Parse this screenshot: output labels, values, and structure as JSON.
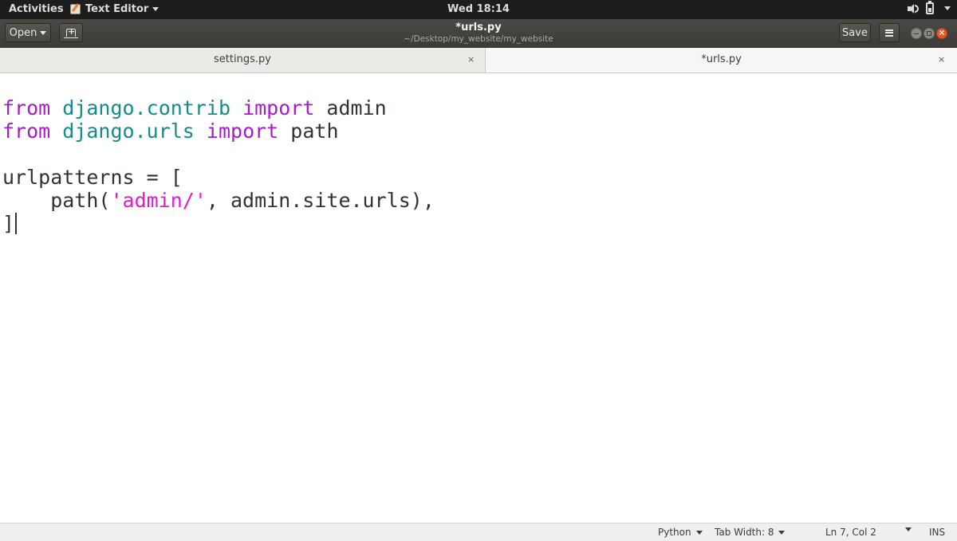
{
  "topbar": {
    "activities": "Activities",
    "app_name": "Text Editor",
    "clock": "Wed 18:14"
  },
  "headerbar": {
    "open_label": "Open",
    "title": "*urls.py",
    "subtitle": "~/Desktop/my_website/my_website",
    "save_label": "Save",
    "close_symbol": "×"
  },
  "tabs": [
    {
      "label": "settings.py",
      "close": "×",
      "active": false
    },
    {
      "label": "*urls.py",
      "close": "×",
      "active": true
    }
  ],
  "editor": {
    "language": "Python",
    "lines": [
      "from django.contrib import admin",
      "from django.urls import path",
      "",
      "urlpatterns = [",
      "    path('admin/', admin.site.urls),",
      "]"
    ],
    "tokens": {
      "l1_kw1": "from",
      "l1_sp1": " ",
      "l1_mod": "django.contrib",
      "l1_sp2": " ",
      "l1_kw2": "import",
      "l1_rest": " admin",
      "l2_kw1": "from",
      "l2_sp1": " ",
      "l2_mod": "django.urls",
      "l2_sp2": " ",
      "l2_kw2": "import",
      "l2_rest": " path",
      "l4": "urlpatterns = [",
      "l5_pre": "    path(",
      "l5_str": "'admin/'",
      "l5_rest": ", admin.site.urls),",
      "l6": "]"
    },
    "colors": {
      "keyword": "#a71cc9",
      "module": "#178a8a",
      "string": "#e01bd6",
      "text": "#2e3436"
    }
  },
  "statusbar": {
    "language": "Python",
    "tab_width": "Tab Width: 8",
    "position": "Ln 7, Col 2",
    "mode": "INS"
  }
}
